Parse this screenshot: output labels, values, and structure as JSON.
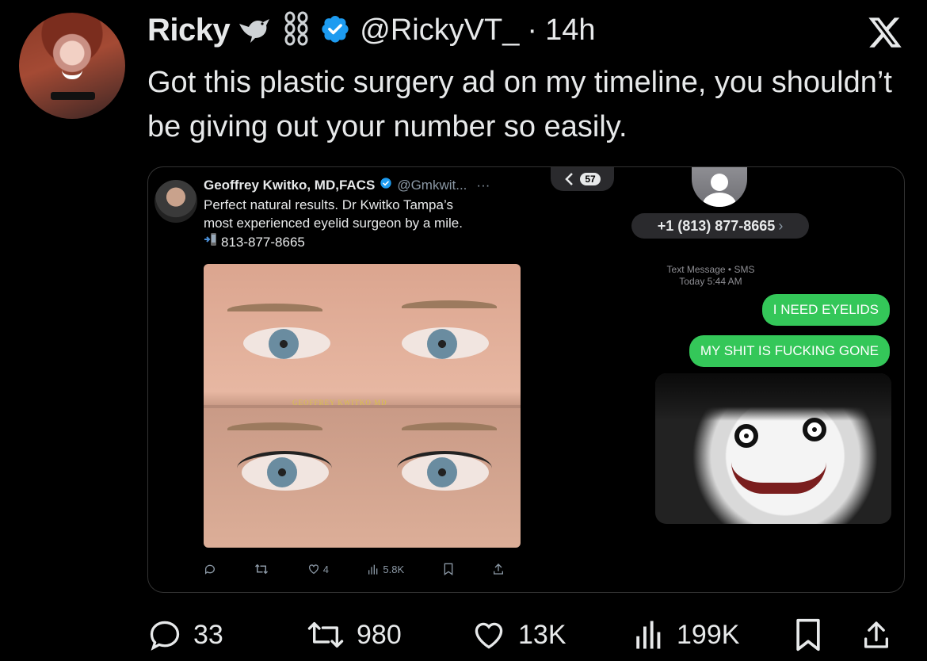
{
  "tweet": {
    "name": "Ricky",
    "handle": "@RickyVT_",
    "separator": "·",
    "time": "14h",
    "text": "Got this plastic surgery ad on my timeline, you shouldn’t be giving out your number so easily."
  },
  "embedded_tweet": {
    "name": "Geoffrey Kwitko, MD,FACS",
    "handle": "@Gmkwit...",
    "more": "···",
    "text_line1": "Perfect natural results. Dr Kwitko Tampa’s",
    "text_line2": "most experienced eyelid surgeon by a mile.",
    "phone": "813-877-8665",
    "watermark": "GEOFFREY KWITKO MD",
    "likes": "4",
    "views": "5.8K"
  },
  "messages": {
    "back_count": "57",
    "contact_number": "+1 (813) 877-8665",
    "chevron": "›",
    "meta_line1": "Text Message • SMS",
    "meta_line2": "Today 5:44 AM",
    "bubble1": "I NEED EYELIDS",
    "bubble2": "MY SHIT IS FUCKING GONE"
  },
  "stats": {
    "replies": "33",
    "retweets": "980",
    "likes": "13K",
    "views": "199K"
  },
  "colors": {
    "background": "#000000",
    "text": "#e7e9ea",
    "verified": "#1d9bf0",
    "imessage_green": "#34c759"
  }
}
